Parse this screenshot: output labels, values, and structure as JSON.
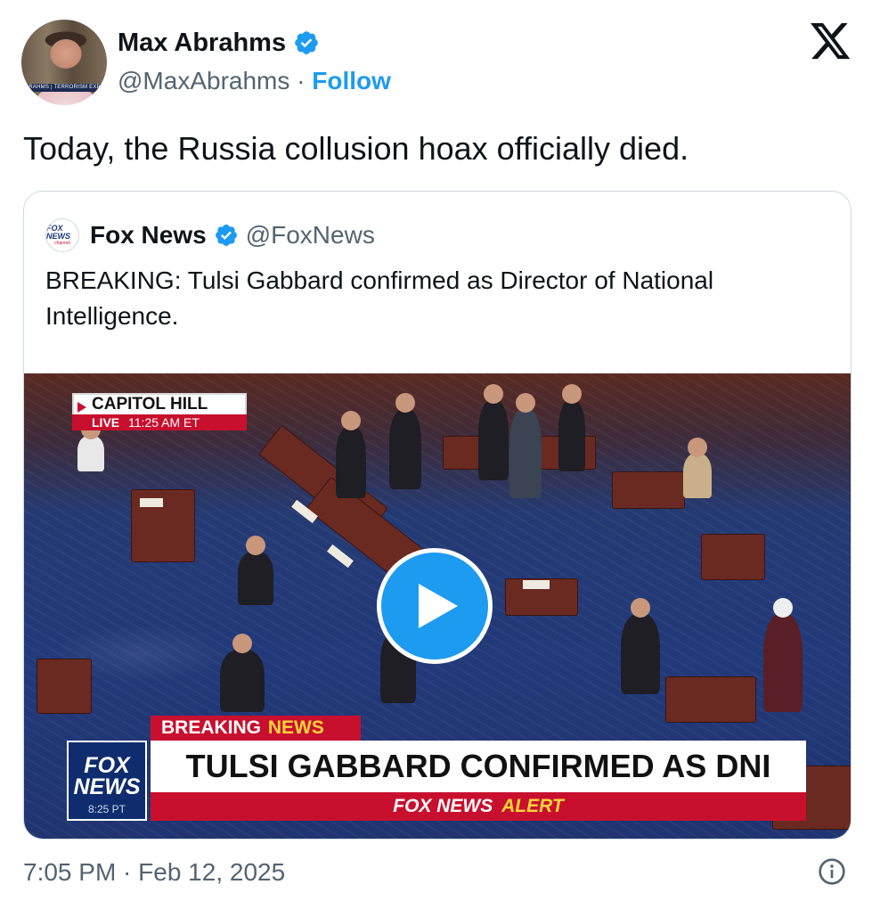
{
  "author": {
    "name": "Max Abrahms",
    "handle": "@MaxAbrahms",
    "separator": "·",
    "follow_label": "Follow",
    "avatar_banner": "ABRAHMS | TERRORISM EXPERT"
  },
  "tweet": {
    "text": "Today, the Russia collusion hoax officially died.",
    "timestamp": "7:05 PM · Feb 12, 2025"
  },
  "quoted": {
    "logo_text": "FOX NEWS",
    "logo_sub": "channel",
    "name": "Fox News",
    "handle": "@FoxNews",
    "text": "BREAKING: Tulsi Gabbard confirmed as Director of National Intelligence."
  },
  "video": {
    "location_label": "CAPITOL HILL",
    "live_label": "LIVE",
    "live_time": "11:25 AM ET",
    "breaking_label": "BREAKING",
    "breaking_news_label": "NEWS",
    "headline": "TULSI GABBARD CONFIRMED AS DNI",
    "alert_prefix": "FOX NEWS",
    "alert_suffix": "ALERT",
    "logo_text": "FOX NEWS",
    "logo_time": "8:25 PT"
  },
  "colors": {
    "accent": "#1d9bf0",
    "text": "#0f1419",
    "muted": "#536471",
    "fox_red": "#c8102e",
    "fox_navy": "#0f2d6e"
  },
  "icons": {
    "verified": "verified-badge-icon",
    "x_logo": "x-logo-icon",
    "play": "play-icon",
    "info": "info-icon"
  }
}
